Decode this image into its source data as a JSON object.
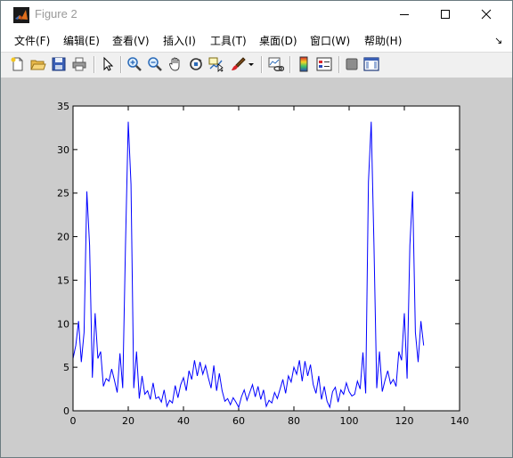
{
  "window": {
    "title": "Figure 2"
  },
  "menu": {
    "items": [
      {
        "label": "文件(F)"
      },
      {
        "label": "编辑(E)"
      },
      {
        "label": "查看(V)"
      },
      {
        "label": "插入(I)"
      },
      {
        "label": "工具(T)"
      },
      {
        "label": "桌面(D)"
      },
      {
        "label": "窗口(W)"
      },
      {
        "label": "帮助(H)"
      }
    ],
    "corner_glyph": "↘"
  },
  "toolbar": {
    "buttons": [
      "new-figure-icon",
      "open-file-icon",
      "save-icon",
      "print-icon",
      "edit-plot-arrow-icon",
      "zoom-in-icon",
      "zoom-out-icon",
      "pan-hand-icon",
      "rotate-3d-icon",
      "data-cursor-icon",
      "brush-icon",
      "brush-dropdown-icon",
      "link-plot-icon",
      "insert-colorbar-icon",
      "insert-legend-icon",
      "hide-plot-tools-icon",
      "show-plot-tools-icon"
    ]
  },
  "colors": {
    "line": "#0000ff",
    "figure_bg": "#cccccc",
    "axes_bg": "#ffffff"
  },
  "chart_data": {
    "type": "line",
    "title": "",
    "xlabel": "",
    "ylabel": "",
    "xlim": [
      0,
      140
    ],
    "ylim": [
      0,
      35
    ],
    "xticks": [
      0,
      20,
      40,
      60,
      80,
      100,
      120,
      140
    ],
    "yticks": [
      0,
      5,
      10,
      15,
      20,
      25,
      30,
      35
    ],
    "grid": false,
    "x_start": 0,
    "series": [
      {
        "color": "#0000ff",
        "values": [
          6.0,
          7.5,
          10.3,
          5.6,
          9.0,
          25.2,
          19.0,
          3.8,
          11.2,
          6.0,
          6.8,
          2.8,
          3.7,
          3.4,
          4.8,
          3.5,
          2.1,
          6.6,
          2.6,
          19.0,
          33.2,
          26.0,
          2.6,
          6.8,
          1.4,
          4.0,
          1.9,
          2.3,
          1.3,
          3.2,
          1.4,
          1.6,
          1.0,
          2.4,
          0.5,
          1.2,
          0.9,
          2.9,
          1.5,
          3.0,
          3.8,
          2.3,
          4.6,
          3.6,
          5.8,
          4.0,
          5.6,
          4.2,
          5.2,
          3.8,
          2.6,
          5.2,
          2.3,
          4.3,
          2.3,
          1.1,
          1.4,
          0.7,
          1.5,
          1.0,
          0.4,
          1.6,
          2.4,
          1.2,
          2.1,
          3.0,
          1.6,
          2.8,
          1.3,
          2.4,
          0.5,
          1.2,
          0.9,
          2.1,
          1.4,
          2.5,
          3.6,
          2.0,
          4.0,
          3.3,
          5.0,
          4.2,
          5.8,
          3.4,
          5.7,
          4.0,
          5.3,
          3.0,
          2.0,
          4.0,
          1.3,
          2.8,
          1.1,
          0.4,
          2.2,
          2.7,
          1.0,
          2.4,
          1.9,
          3.2,
          2.2,
          1.7,
          1.9,
          3.4,
          2.5,
          6.7,
          2.0,
          26.3,
          33.2,
          19.0,
          2.6,
          6.8,
          2.2,
          3.5,
          4.6,
          3.1,
          3.6,
          2.8,
          6.8,
          5.8,
          11.2,
          3.7,
          19.0,
          25.2,
          9.0,
          5.6,
          10.3,
          7.5
        ]
      }
    ]
  }
}
